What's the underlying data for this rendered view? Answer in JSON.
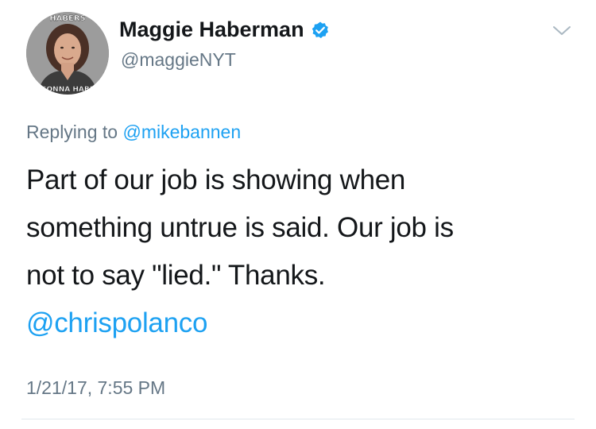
{
  "tweet": {
    "author": {
      "name": "Maggie Haberman",
      "handle": "@maggieNYT",
      "verified": true,
      "avatar_top_text": "HABERS",
      "avatar_bottom_text": "GONNA HABE"
    },
    "replying": {
      "prefix": "Replying to ",
      "mention": "@mikebannen"
    },
    "body": {
      "lines": [
        "Part of our job is showing when",
        "something untrue is said. Our job is",
        "not to say \"lied.\" Thanks."
      ],
      "mention": "@chrispolanco"
    },
    "timestamp": "1/21/17, 7:55 PM"
  },
  "colors": {
    "link": "#1da1f2",
    "secondary_text": "#657786",
    "primary_text": "#14171a",
    "divider": "#e1e8ed"
  },
  "icons": [
    "verified-icon",
    "chevron-down-icon"
  ]
}
